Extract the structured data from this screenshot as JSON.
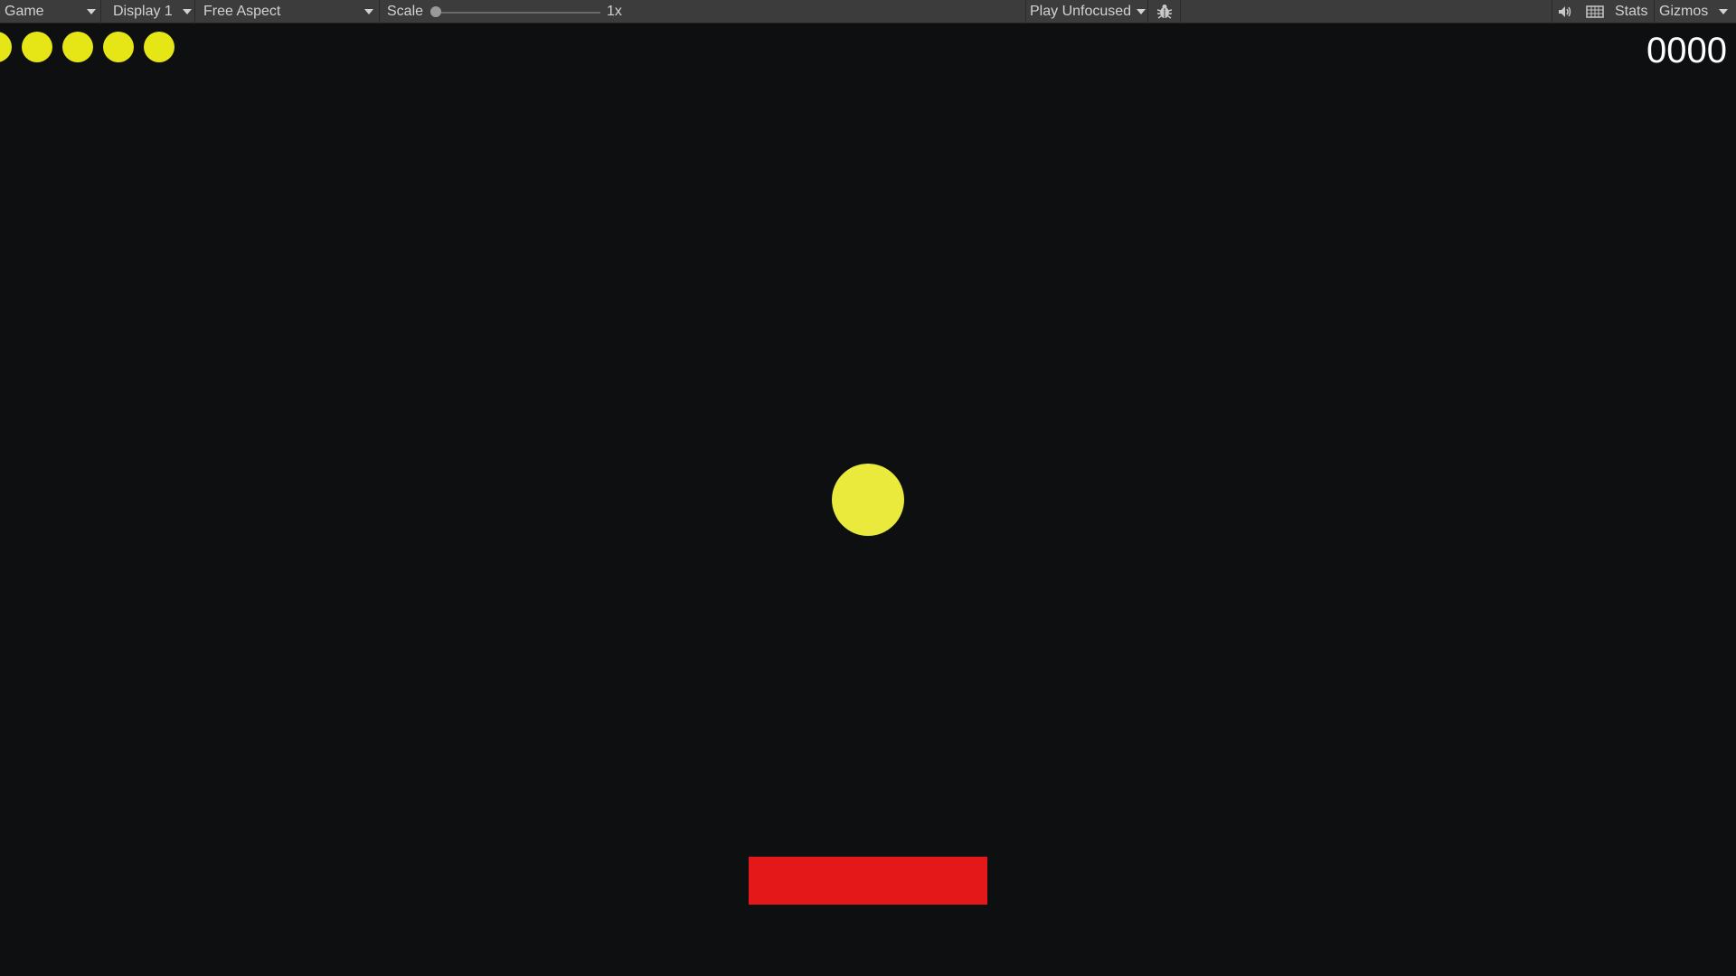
{
  "toolbar": {
    "view_dropdown": "Game",
    "display_dropdown": "Display 1",
    "aspect_dropdown": "Free Aspect",
    "scale_label": "Scale",
    "scale_value": "1x",
    "scale_level": 0,
    "play_mode_dropdown": "Play Unfocused",
    "stats_label": "Stats",
    "gizmos_label": "Gizmos",
    "icons": [
      "debug-bug-icon",
      "audio-mute-icon",
      "keyboard-grid-icon"
    ]
  },
  "game": {
    "score": "0000",
    "lives": 5,
    "colors": {
      "background": "#0d0f11",
      "ball": "#e9ea3c",
      "lives": "#e6e616",
      "paddle": "#e41818",
      "score_text": "#ffffff"
    }
  }
}
